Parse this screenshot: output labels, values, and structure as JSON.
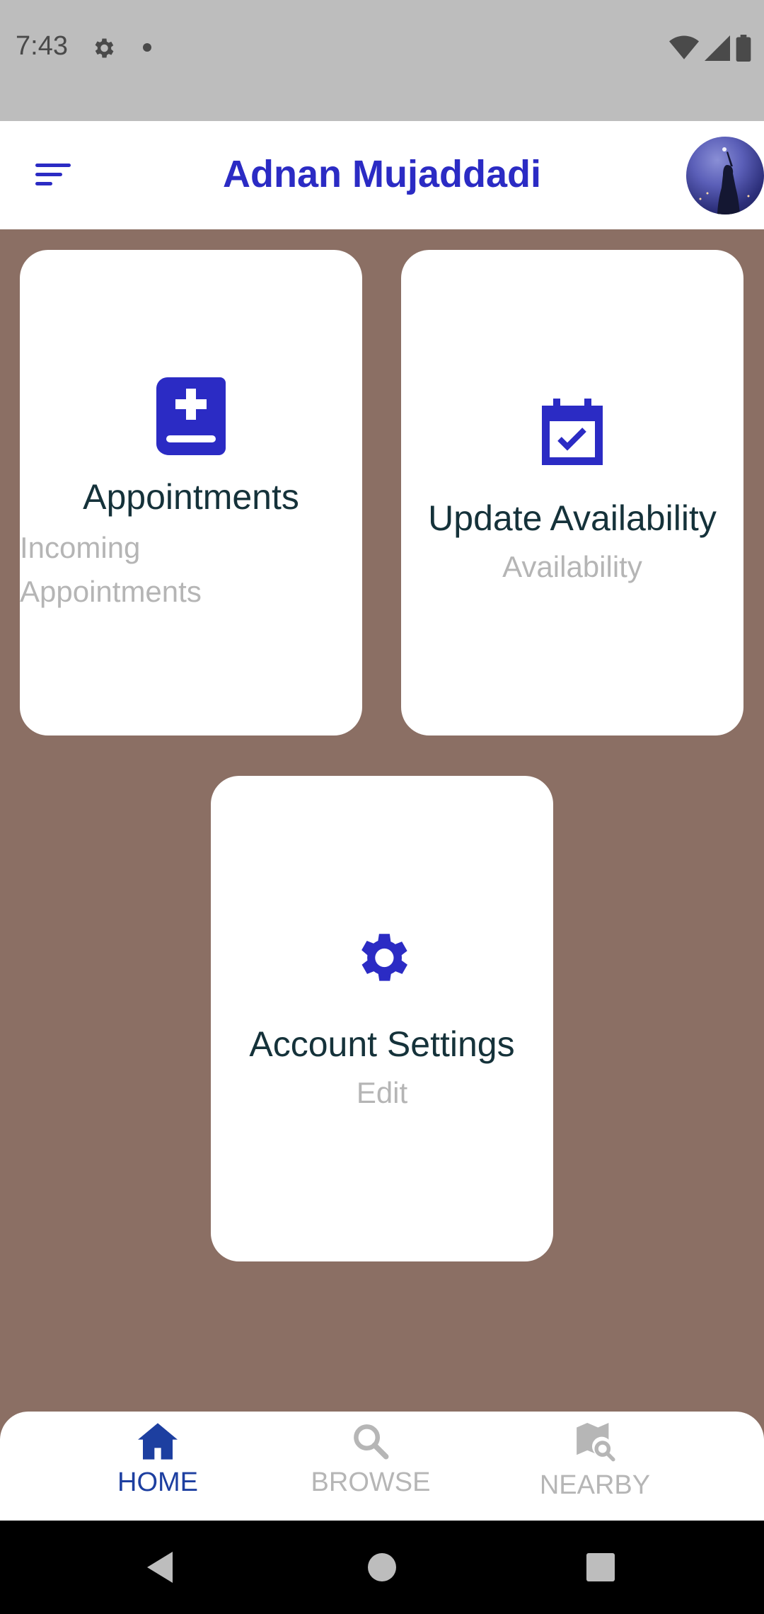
{
  "status_bar": {
    "time": "7:43"
  },
  "header": {
    "title": "Adnan Mujaddadi"
  },
  "cards": {
    "appointments": {
      "title": "Appointments",
      "subtitle_line1": "Incoming",
      "subtitle_line2": "Appointments",
      "icon": "medical-book-icon"
    },
    "availability": {
      "title": "Update Availability",
      "subtitle": "Availability",
      "icon": "calendar-check-icon"
    },
    "settings": {
      "title": "Account Settings",
      "subtitle": "Edit",
      "icon": "gear-icon"
    }
  },
  "bottom_nav": {
    "home": "HOME",
    "browse": "BROWSE",
    "nearby": "NEARBY"
  },
  "colors": {
    "accent": "#2b2bc4",
    "background": "#8b6f64",
    "nav_active": "#1d3fa0",
    "nav_inactive": "#b6b6b6"
  }
}
